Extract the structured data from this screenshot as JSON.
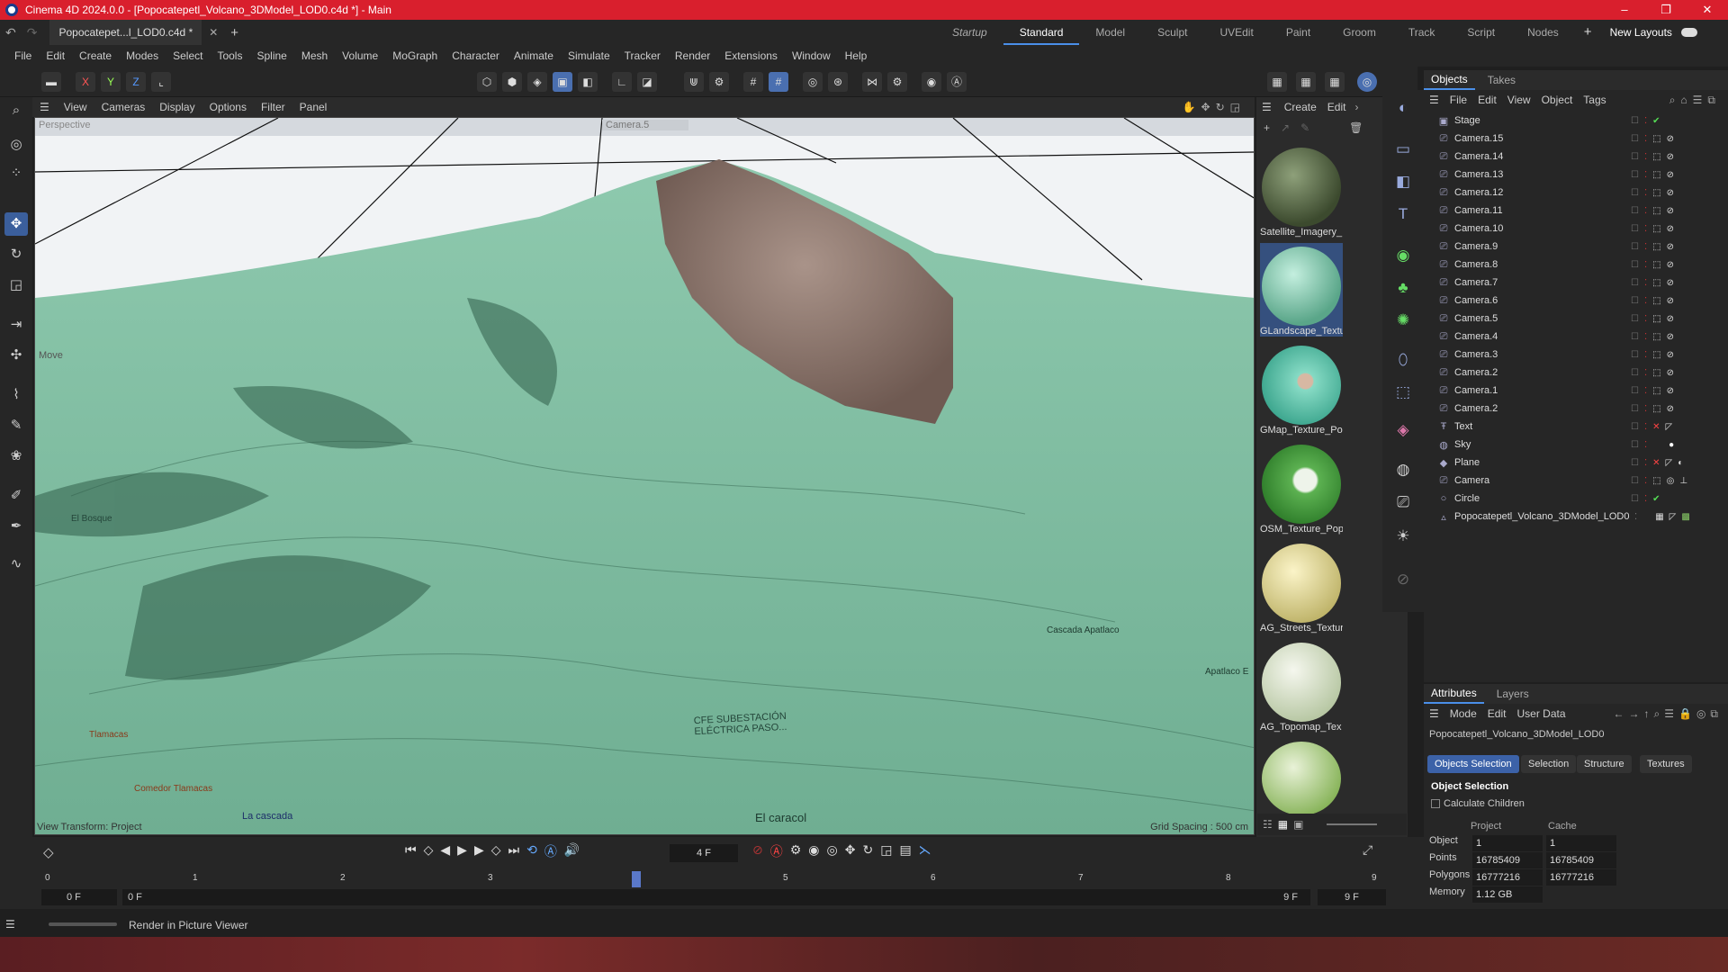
{
  "window": {
    "title": "Cinema 4D 2024.0.0 - [Popocatepetl_Volcano_3DModel_LOD0.c4d *] - Main",
    "minimize": "–",
    "maximize": "❐",
    "close": "✕"
  },
  "tabs": {
    "doc_tab": "Popocatepet...l_LOD0.c4d *",
    "layouts": [
      "Startup",
      "Standard",
      "Model",
      "Sculpt",
      "UVEdit",
      "Paint",
      "Groom",
      "Track",
      "Script",
      "Nodes"
    ],
    "active_layout": "Standard",
    "new_layouts": "New Layouts"
  },
  "menu": [
    "File",
    "Edit",
    "Create",
    "Modes",
    "Select",
    "Tools",
    "Spline",
    "Mesh",
    "Volume",
    "MoGraph",
    "Character",
    "Animate",
    "Simulate",
    "Tracker",
    "Render",
    "Extensions",
    "Window",
    "Help"
  ],
  "toolbar": {
    "x": "X",
    "y": "Y",
    "z": "Z"
  },
  "viewport": {
    "menu": [
      "View",
      "Cameras",
      "Display",
      "Options",
      "Filter",
      "Panel"
    ],
    "mode_label": "Perspective",
    "camera_label": "Camera.5",
    "move_label": "Move",
    "view_transform": "View Transform: Project",
    "grid_spacing": "Grid Spacing : 500 cm",
    "map_labels": [
      "CFE SUBESTACIÓN ELÉCTRICA PASO...",
      "El caracol",
      "Cascada Apatlaco",
      "Apatlaco E",
      "La cascada",
      "Comedor Tlamacas",
      "Tlamacas",
      "El Bosque"
    ]
  },
  "materials": {
    "menu": [
      "Create",
      "Edit"
    ],
    "items": [
      {
        "label": "Satellite_Imagery_"
      },
      {
        "label": "GLandscape_Textu"
      },
      {
        "label": "GMap_Texture_Po"
      },
      {
        "label": "OSM_Texture_Pop"
      },
      {
        "label": "AG_Streets_Textur"
      },
      {
        "label": "AG_Topomap_Tex"
      },
      {
        "label": ""
      }
    ]
  },
  "objects_panel": {
    "tabs": [
      "Objects",
      "Takes"
    ],
    "menu": [
      "File",
      "Edit",
      "View",
      "Object",
      "Tags"
    ],
    "rows": [
      {
        "name": "Stage"
      },
      {
        "name": "Camera.15"
      },
      {
        "name": "Camera.14"
      },
      {
        "name": "Camera.13"
      },
      {
        "name": "Camera.12"
      },
      {
        "name": "Camera.11"
      },
      {
        "name": "Camera.10"
      },
      {
        "name": "Camera.9"
      },
      {
        "name": "Camera.8"
      },
      {
        "name": "Camera.7"
      },
      {
        "name": "Camera.6"
      },
      {
        "name": "Camera.5"
      },
      {
        "name": "Camera.4"
      },
      {
        "name": "Camera.3"
      },
      {
        "name": "Camera.2"
      },
      {
        "name": "Camera.1"
      },
      {
        "name": "Camera.2"
      },
      {
        "name": "Text"
      },
      {
        "name": "Sky"
      },
      {
        "name": "Plane"
      },
      {
        "name": "Camera"
      },
      {
        "name": "Circle"
      },
      {
        "name": "Popocatepetl_Volcano_3DModel_LOD0"
      }
    ]
  },
  "attributes": {
    "tabs": [
      "Attributes",
      "Layers"
    ],
    "menu": [
      "Mode",
      "Edit",
      "User Data"
    ],
    "object_name": "Popocatepetl_Volcano_3DModel_LOD0",
    "chips": [
      "Objects Selection",
      "Selection",
      "Structure",
      "Textures"
    ],
    "section": "Object Selection",
    "calc_children": "Calculate Children",
    "col_project": "Project",
    "col_cache": "Cache",
    "rows": [
      {
        "label": "Object",
        "project": "1",
        "cache": "1"
      },
      {
        "label": "Points",
        "project": "16785409",
        "cache": "16785409"
      },
      {
        "label": "Polygons",
        "project": "16777216",
        "cache": "16777216"
      },
      {
        "label": "Memory",
        "project": "1.12 GB",
        "cache": ""
      }
    ]
  },
  "timeline": {
    "current_frame": "4 F",
    "ticks": [
      "0",
      "1",
      "2",
      "3",
      "4",
      "5",
      "6",
      "7",
      "8",
      "9"
    ],
    "start": "0 F",
    "start2": "0 F",
    "end": "9 F",
    "end2": "9 F"
  },
  "status": {
    "text": "Render in Picture Viewer"
  },
  "colors": {
    "title_red": "#d91f2d",
    "accent_blue": "#4a8fe8",
    "terrain_green": "#7fbfa0",
    "rock_brown": "#8a6e62"
  }
}
